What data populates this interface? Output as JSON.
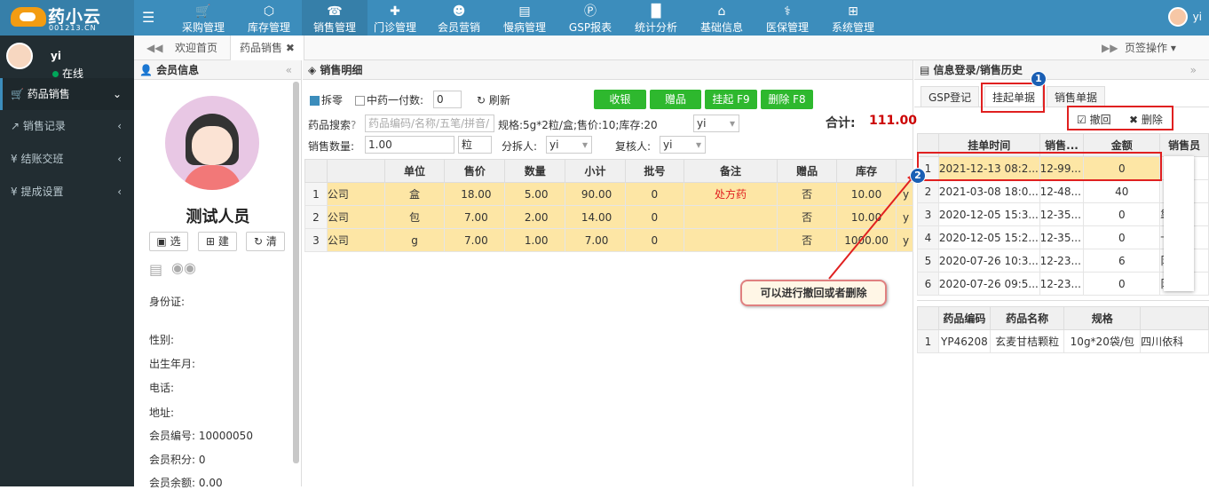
{
  "logo": {
    "brand": "药小云",
    "sub": "001213.CN"
  },
  "topnav": {
    "items": [
      {
        "label": "采购管理",
        "icon": "cart-icon"
      },
      {
        "label": "库存管理",
        "icon": "cube-icon"
      },
      {
        "label": "销售管理",
        "icon": "phone-icon"
      },
      {
        "label": "门诊管理",
        "icon": "medkit-icon"
      },
      {
        "label": "会员营销",
        "icon": "users-icon"
      },
      {
        "label": "慢病管理",
        "icon": "clipboard-icon"
      },
      {
        "label": "GSP报表",
        "icon": "p-icon"
      },
      {
        "label": "统计分析",
        "icon": "bar-chart-icon"
      },
      {
        "label": "基础信息",
        "icon": "bank-icon"
      },
      {
        "label": "医保管理",
        "icon": "medical-icon"
      },
      {
        "label": "系统管理",
        "icon": "windows-icon"
      }
    ],
    "user": "yi"
  },
  "sidebar": {
    "user_name": "yi",
    "status": "在线",
    "items": [
      {
        "label": "药品销售",
        "arrow": "⌄"
      },
      {
        "label": "销售记录",
        "arrow": "‹"
      },
      {
        "label": "结账交班",
        "arrow": "‹"
      },
      {
        "label": "提成设置",
        "arrow": "‹"
      }
    ]
  },
  "tabbar": {
    "tabs": [
      "欢迎首页",
      "药品销售"
    ],
    "page_ops": "页签操作"
  },
  "member": {
    "title": "会员信息",
    "name": "测试人员",
    "buttons": [
      "选",
      "建",
      "清"
    ],
    "fields": [
      {
        "label": "身份证:",
        "value": ""
      },
      {
        "label": "性别:",
        "value": ""
      },
      {
        "label": "出生年月:",
        "value": ""
      },
      {
        "label": "电话:",
        "value": ""
      },
      {
        "label": "地址:",
        "value": ""
      },
      {
        "label": "会员编号:",
        "value": "10000050"
      },
      {
        "label": "会员积分:",
        "value": "0"
      },
      {
        "label": "会员余额:",
        "value": "0.00"
      }
    ]
  },
  "sales": {
    "title": "销售明细",
    "split_label": "拆零",
    "herbal_label": "中药一付数:",
    "herbal_value": "0",
    "refresh": "刷新",
    "buttons": [
      "收银",
      "赠品",
      "挂起 F9",
      "删除 F8"
    ],
    "total_label": "合计:",
    "total_value": "111.00",
    "search_label": "药品搜索",
    "search_placeholder": "药品编码/名称/五笔/拼音/",
    "spec_info": "规格:5g*2粒/盒;售价:10;库存:20",
    "spec_select": "yi",
    "qty_label": "销售数量:",
    "qty_value": "1.00",
    "qty_unit": "粒",
    "splitter_label": "分拆人:",
    "splitter_value": "yi",
    "reviewer_label": "复核人:",
    "reviewer_value": "yi",
    "columns": [
      "",
      "单位",
      "售价",
      "数量",
      "小计",
      "批号",
      "备注",
      "赠品",
      "库存"
    ],
    "rows": [
      {
        "n": "1",
        "name": "公司",
        "unit": "盒",
        "price": "18.00",
        "qty": "5.00",
        "subtotal": "90.00",
        "batch": "0",
        "note": "处方药",
        "gift": "否",
        "stock": "10.00",
        "tail": "y"
      },
      {
        "n": "2",
        "name": "公司",
        "unit": "包",
        "price": "7.00",
        "qty": "2.00",
        "subtotal": "14.00",
        "batch": "0",
        "note": "",
        "gift": "否",
        "stock": "10.00",
        "tail": "y"
      },
      {
        "n": "3",
        "name": "公司",
        "unit": "g",
        "price": "7.00",
        "qty": "1.00",
        "subtotal": "7.00",
        "batch": "0",
        "note": "",
        "gift": "否",
        "stock": "1000.00",
        "tail": "y"
      }
    ]
  },
  "callout": "可以进行撤回或者删除",
  "right": {
    "title": "信息登录/销售历史",
    "tabs": [
      "GSP登记",
      "挂起单据",
      "销售单据"
    ],
    "actions": [
      "撤回",
      "删除"
    ],
    "columns": [
      "挂单时间",
      "销售...",
      "金额",
      "销售员"
    ],
    "rows": [
      {
        "n": "1",
        "time": "2021-12-13 08:2...",
        "code": "12-99...",
        "amount": "0",
        "seller": ""
      },
      {
        "n": "2",
        "time": "2021-03-08 18:0...",
        "code": "12-48...",
        "amount": "40",
        "seller": ""
      },
      {
        "n": "3",
        "time": "2020-12-05 15:3...",
        "code": "12-35...",
        "amount": "0",
        "seller": "靠"
      },
      {
        "n": "4",
        "time": "2020-12-05 15:2...",
        "code": "12-35...",
        "amount": "0",
        "seller": "卡"
      },
      {
        "n": "5",
        "time": "2020-07-26 10:3...",
        "code": "12-23...",
        "amount": "6",
        "seller": "阝"
      },
      {
        "n": "6",
        "time": "2020-07-26 09:5...",
        "code": "12-23...",
        "amount": "0",
        "seller": "阝"
      }
    ],
    "detail_columns": [
      "药品编码",
      "药品名称",
      "规格",
      ""
    ],
    "detail_rows": [
      {
        "n": "1",
        "code": "YP46208",
        "name": "玄麦甘桔颗粒",
        "spec": "10g*20袋/包",
        "maker": "四川依科"
      }
    ],
    "badges": [
      "1",
      "2"
    ]
  }
}
